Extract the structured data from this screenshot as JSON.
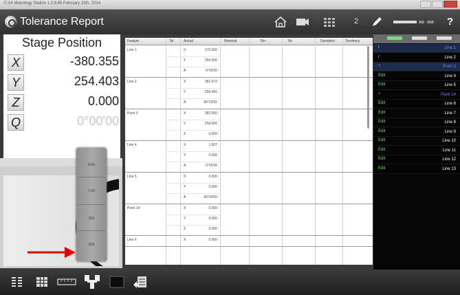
{
  "window": {
    "title": "IT-04 Metrology Station 1.0.8.85 February 15th, 2014"
  },
  "header": {
    "title": "Tolerance Report",
    "icons": [
      "home-icon",
      "camera-icon",
      "grid-icon",
      "pen-icon",
      "slider-icon",
      "help-icon"
    ],
    "count": "2",
    "help": "?"
  },
  "stage": {
    "title": "Stage Position",
    "axes": [
      {
        "label": "X",
        "value": "-380.355"
      },
      {
        "label": "Y",
        "value": "254.403"
      },
      {
        "label": "Z",
        "value": "0.000"
      },
      {
        "label": "Q",
        "value": "0°00'00"
      }
    ]
  },
  "zoom": {
    "levels": [
      "0.6X",
      "7.5X",
      "15X",
      "20X"
    ]
  },
  "table": {
    "columns": [
      "Feature",
      "Tol",
      "Actual",
      "Nominal",
      "Tol+",
      "Tol-",
      "Deviation",
      "Tendency"
    ],
    "rows": [
      {
        "feature": "Line 1",
        "sub": [
          [
            "X",
            "370.000"
          ],
          [
            "Y",
            "254.000"
          ],
          [
            "A",
            "0°00'00"
          ]
        ]
      },
      {
        "feature": "Line 2",
        "sub": [
          [
            "X",
            "381.672"
          ],
          [
            "Y",
            "256.456"
          ],
          [
            "A",
            "89°20'50"
          ]
        ]
      },
      {
        "feature": "Point 3",
        "sub": [
          [
            "X",
            "381.000"
          ],
          [
            "Y",
            "254.000"
          ],
          [
            "Z",
            "0.000"
          ]
        ]
      },
      {
        "feature": "Line 4",
        "sub": [
          [
            "X",
            "1.007"
          ],
          [
            "Y",
            "0.000"
          ],
          [
            "A",
            "0°00'00"
          ]
        ]
      },
      {
        "feature": "Line 5",
        "sub": [
          [
            "X",
            "0.000"
          ],
          [
            "Y",
            "0.000"
          ],
          [
            "A",
            "90°00'00"
          ]
        ]
      },
      {
        "feature": "Point 14",
        "sub": [
          [
            "X",
            "0.000"
          ],
          [
            "Y",
            "0.000"
          ],
          [
            "Z",
            "0.000"
          ]
        ]
      },
      {
        "feature": "Line 6",
        "sub": [
          [
            "X",
            "0.000"
          ]
        ]
      }
    ]
  },
  "features": [
    {
      "icon": "/",
      "name": "Line 1",
      "highlight": true,
      "selected": true
    },
    {
      "icon": "/",
      "name": "Line 2",
      "highlight": false,
      "selected": false
    },
    {
      "icon": "+",
      "name": "Point 3",
      "highlight": true,
      "selected": true
    },
    {
      "icon": "Edit",
      "name": "Line 4",
      "highlight": false,
      "selected": false
    },
    {
      "icon": "Edit",
      "name": "Line 5",
      "highlight": false,
      "selected": false
    },
    {
      "icon": "+",
      "name": "Point 14",
      "highlight": true,
      "selected": false
    },
    {
      "icon": "Edit",
      "name": "Line 6",
      "highlight": false,
      "selected": false
    },
    {
      "icon": "Edit",
      "name": "Line 7",
      "highlight": false,
      "selected": false
    },
    {
      "icon": "Edit",
      "name": "Line 8",
      "highlight": false,
      "selected": false
    },
    {
      "icon": "Edit",
      "name": "Line 9",
      "highlight": false,
      "selected": false
    },
    {
      "icon": "Edit",
      "name": "Line 10",
      "highlight": false,
      "selected": false
    },
    {
      "icon": "Edit",
      "name": "Line 11",
      "highlight": false,
      "selected": false
    },
    {
      "icon": "Edit",
      "name": "Line 12",
      "highlight": false,
      "selected": false
    },
    {
      "icon": "Edit",
      "name": "Line 13",
      "highlight": false,
      "selected": false
    }
  ],
  "toolbar": {
    "icons": [
      "statistics-icon",
      "table-icon",
      "scale-icon",
      "tree-icon",
      "black-box-icon",
      "report-icon"
    ]
  },
  "colors": {
    "accent": "#e00000",
    "highlight": "#7b82ff",
    "header": "#3c3c3c",
    "list_bg": "#050505"
  }
}
